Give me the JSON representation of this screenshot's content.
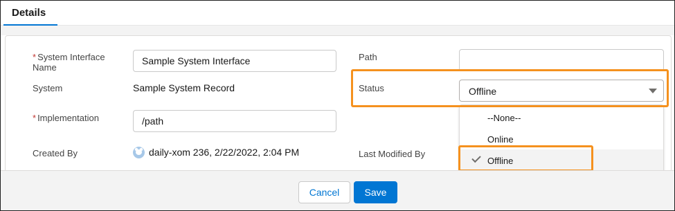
{
  "tabs": {
    "details_label": "Details"
  },
  "fields": {
    "system_interface_name": {
      "label": "System Interface Name",
      "required_marker": "*",
      "value": "Sample System Interface"
    },
    "system": {
      "label": "System",
      "value": "Sample System Record"
    },
    "implementation": {
      "label": "Implementation",
      "required_marker": "*",
      "value": "/path"
    },
    "created_by": {
      "label": "Created By",
      "value": "daily-xom 236, 2/22/2022, 2:04 PM"
    },
    "path": {
      "label": "Path",
      "value": ""
    },
    "status": {
      "label": "Status",
      "value": "Offline"
    },
    "last_modified_by": {
      "label": "Last Modified By"
    }
  },
  "status_dropdown": {
    "options": [
      "--None--",
      "Online",
      "Offline"
    ],
    "selected": "Offline"
  },
  "footer": {
    "cancel_label": "Cancel",
    "save_label": "Save"
  },
  "colors": {
    "accent": "#0176d3",
    "highlight": "#f5911e",
    "required": "#c23934"
  },
  "icons": {
    "avatar": "user-avatar-icon",
    "check": "check-icon",
    "caret": "chevron-down-icon"
  }
}
